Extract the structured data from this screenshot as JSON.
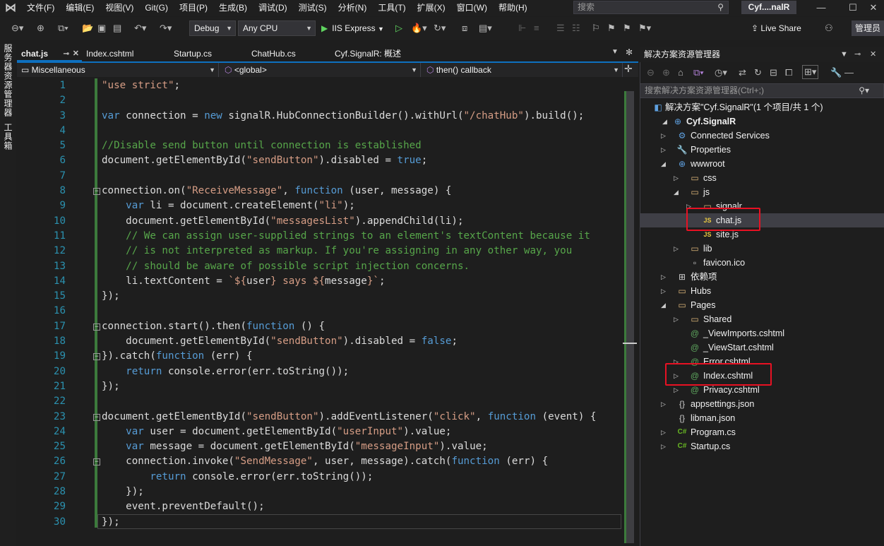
{
  "menu": {
    "items": [
      "文件(F)",
      "编辑(E)",
      "视图(V)",
      "Git(G)",
      "项目(P)",
      "生成(B)",
      "调试(D)",
      "测试(S)",
      "分析(N)",
      "工具(T)",
      "扩展(X)",
      "窗口(W)",
      "帮助(H)"
    ],
    "search_placeholder": "搜索",
    "solution_title": "Cyf....nalR"
  },
  "toolbar": {
    "config": "Debug",
    "platform": "Any CPU",
    "run_label": "IIS Express",
    "live_share": "Live Share",
    "admin": "管理员"
  },
  "left_strip": {
    "tab1": "服务器资源管理器",
    "tab2": "工具箱"
  },
  "editor_tabs": [
    {
      "label": "chat.js",
      "active": true
    },
    {
      "label": "Index.cshtml",
      "active": false
    },
    {
      "label": "Startup.cs",
      "active": false
    },
    {
      "label": "ChatHub.cs",
      "active": false
    },
    {
      "label": "Cyf.SignalR: 概述",
      "active": false
    }
  ],
  "navbar": {
    "scope": "Miscellaneous",
    "context": "<global>",
    "member": "then() callback"
  },
  "code": {
    "line_numbers": [
      "1",
      "2",
      "3",
      "4",
      "5",
      "6",
      "7",
      "8",
      "9",
      "10",
      "11",
      "12",
      "13",
      "14",
      "15",
      "16",
      "17",
      "18",
      "19",
      "20",
      "21",
      "22",
      "23",
      "24",
      "25",
      "26",
      "27",
      "28",
      "29",
      "30"
    ]
  },
  "solution_explorer": {
    "title": "解决方案资源管理器",
    "search_placeholder": "搜索解决方案资源管理器(Ctrl+;)",
    "nodes": [
      {
        "label": "解决方案\"Cyf.SignalR\"(1 个项目/共 1 个)",
        "icon": "solution-icon"
      },
      {
        "label": "Cyf.SignalR",
        "icon": "web-project-icon"
      },
      {
        "label": "Connected Services",
        "icon": "connected-services-icon"
      },
      {
        "label": "Properties",
        "icon": "properties-icon"
      },
      {
        "label": "wwwroot",
        "icon": "globe-icon"
      },
      {
        "label": "css",
        "icon": "folder-icon"
      },
      {
        "label": "js",
        "icon": "folder-open-icon"
      },
      {
        "label": "signalr",
        "icon": "folder-icon"
      },
      {
        "label": "chat.js",
        "icon": "js-file-icon"
      },
      {
        "label": "site.js",
        "icon": "js-file-icon"
      },
      {
        "label": "lib",
        "icon": "folder-icon"
      },
      {
        "label": "favicon.ico",
        "icon": "image-file-icon"
      },
      {
        "label": "依赖项",
        "icon": "dependencies-icon"
      },
      {
        "label": "Hubs",
        "icon": "folder-icon"
      },
      {
        "label": "Pages",
        "icon": "folder-open-icon"
      },
      {
        "label": "Shared",
        "icon": "folder-icon"
      },
      {
        "label": "_ViewImports.cshtml",
        "icon": "razor-file-icon"
      },
      {
        "label": "_ViewStart.cshtml",
        "icon": "razor-file-icon"
      },
      {
        "label": "Error.cshtml",
        "icon": "razor-file-icon"
      },
      {
        "label": "Index.cshtml",
        "icon": "razor-file-icon"
      },
      {
        "label": "Privacy.cshtml",
        "icon": "razor-file-icon"
      },
      {
        "label": "appsettings.json",
        "icon": "json-file-icon"
      },
      {
        "label": "libman.json",
        "icon": "json-file-icon"
      },
      {
        "label": "Program.cs",
        "icon": "csharp-file-icon"
      },
      {
        "label": "Startup.cs",
        "icon": "csharp-file-icon"
      }
    ]
  },
  "colors": {
    "keyword": "#569cd6",
    "string": "#d69d85",
    "comment": "#57a64a",
    "highlight_box": "#e81123"
  }
}
